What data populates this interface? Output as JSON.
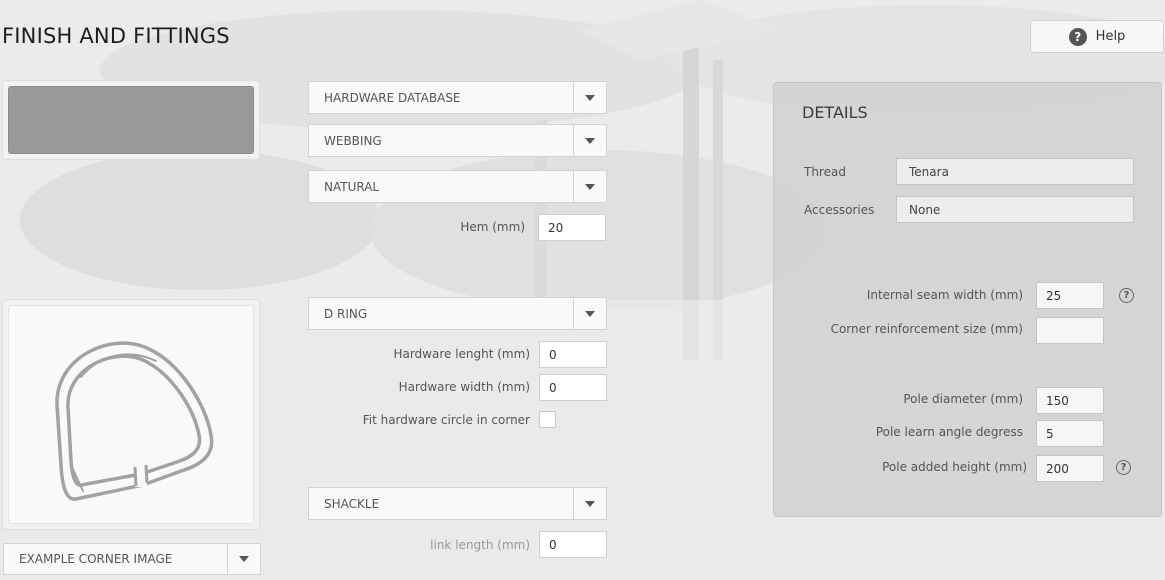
{
  "page": {
    "title": "FINISH AND FITTINGS"
  },
  "help": {
    "label": "Help",
    "icon": "help-circle-icon"
  },
  "swatch": {
    "color": "#999999"
  },
  "corner_image_select": {
    "value": "EXAMPLE CORNER IMAGE"
  },
  "fittings": {
    "hardware_database": "HARDWARE DATABASE",
    "webbing": "WEBBING",
    "natural": "NATURAL",
    "hem_label": "Hem (mm)",
    "hem_value": "20",
    "d_ring": "D RING",
    "hardware_length_label": "Hardware lenght (mm)",
    "hardware_length_value": "0",
    "hardware_width_label": "Hardware width (mm)",
    "hardware_width_value": "0",
    "fit_circle_label": "Fit hardware circle in corner",
    "shackle": "SHACKLE",
    "link_length_label": "link length (mm)",
    "link_length_value": "0"
  },
  "details": {
    "title": "DETAILS",
    "thread_label": "Thread",
    "thread_value": "Tenara",
    "accessories_label": "Accessories",
    "accessories_value": "None",
    "internal_seam_label": "Internal seam width (mm)",
    "internal_seam_value": "25",
    "corner_reinforcement_label": "Corner reinforcement size (mm)",
    "corner_reinforcement_value": "",
    "pole_diameter_label": "Pole diameter (mm)",
    "pole_diameter_value": "150",
    "pole_angle_label": "Pole learn angle degress",
    "pole_angle_value": "5",
    "pole_height_label": "Pole added height (mm)",
    "pole_height_value": "200",
    "info_icon": "?"
  }
}
